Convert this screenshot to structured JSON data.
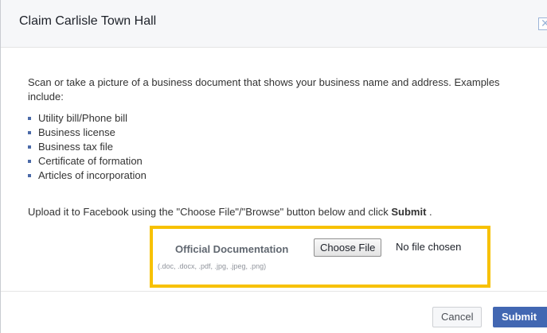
{
  "dialog": {
    "title": "Claim Carlisle Town Hall",
    "close_icon": "close-icon"
  },
  "body": {
    "intro": "Scan or take a picture of a business document that shows your business name and address. Examples include:",
    "examples": [
      "Utility bill/Phone bill",
      "Business license",
      "Business tax file",
      "Certificate of formation",
      "Articles of incorporation"
    ],
    "upload_prefix": "Upload it to Facebook using the \"Choose File\"/\"Browse\" button below and click ",
    "upload_bold": "Submit",
    "upload_suffix": " ."
  },
  "upload": {
    "label": "Official Documentation",
    "formats": "(.doc, .docx, .pdf, .jpg, .jpeg, .png)",
    "choose_file_label": "Choose File",
    "file_status": "No file chosen"
  },
  "footer": {
    "cancel_label": "Cancel",
    "submit_label": "Submit"
  },
  "colors": {
    "highlight": "#f7c100",
    "primary": "#4267b2",
    "bullet": "#4b6aa8"
  }
}
